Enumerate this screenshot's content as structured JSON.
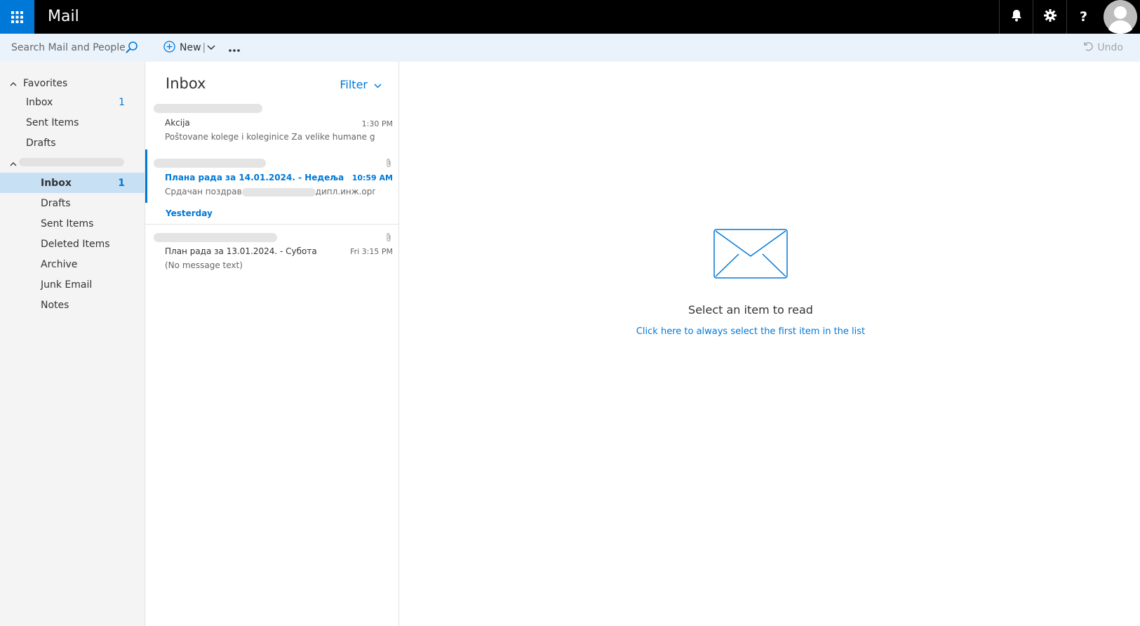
{
  "app": {
    "title": "Mail"
  },
  "topbar": {
    "icons": [
      "waffle-icon",
      "bell-icon",
      "gear-icon",
      "help-icon",
      "avatar"
    ]
  },
  "search": {
    "placeholder": "Search Mail and People"
  },
  "toolbar": {
    "new_label": "New",
    "new_separator": "|",
    "more_icon": "ellipsis-icon",
    "undo_label": "Undo"
  },
  "nav": {
    "favorites_header": "Favorites",
    "favorites": [
      {
        "label": "Inbox",
        "count": "1"
      },
      {
        "label": "Sent Items",
        "count": ""
      },
      {
        "label": "Drafts",
        "count": ""
      }
    ],
    "account_folders": [
      {
        "label": "Inbox",
        "count": "1",
        "selected": true
      },
      {
        "label": "Drafts",
        "count": ""
      },
      {
        "label": "Sent Items",
        "count": ""
      },
      {
        "label": "Deleted Items",
        "count": ""
      },
      {
        "label": "Archive",
        "count": ""
      },
      {
        "label": "Junk Email",
        "count": ""
      },
      {
        "label": "Notes",
        "count": ""
      }
    ]
  },
  "list": {
    "title": "Inbox",
    "filter_label": "Filter",
    "group_yesterday": "Yesterday",
    "messages": [
      {
        "subject": "Akcija",
        "time": "1:30 PM",
        "preview": "Poštovane kolege i koleginice Za velike humane gestove ...",
        "unread": false,
        "attachment": false
      },
      {
        "subject": "Плана рада за 14.01.2024. - Недеља",
        "time": "10:59 AM",
        "preview_start": "Срдачан поздрав",
        "preview_end": "дипл.инж.орг.на...",
        "unread": true,
        "attachment": true,
        "selected": true
      },
      {
        "subject": "План рада за 13.01.2024. - Субота",
        "time": "Fri 3:15 PM",
        "preview": "(No message text)",
        "unread": false,
        "attachment": true
      }
    ]
  },
  "reading_pane": {
    "empty_title": "Select an item to read",
    "empty_link": "Click here to always select the first item in the list"
  },
  "colors": {
    "accent": "#0078d7",
    "topbar": "#000000",
    "command_bar": "#eaf3fb",
    "nav_bg": "#f4f4f4",
    "nav_selected": "#c7e0f4"
  }
}
